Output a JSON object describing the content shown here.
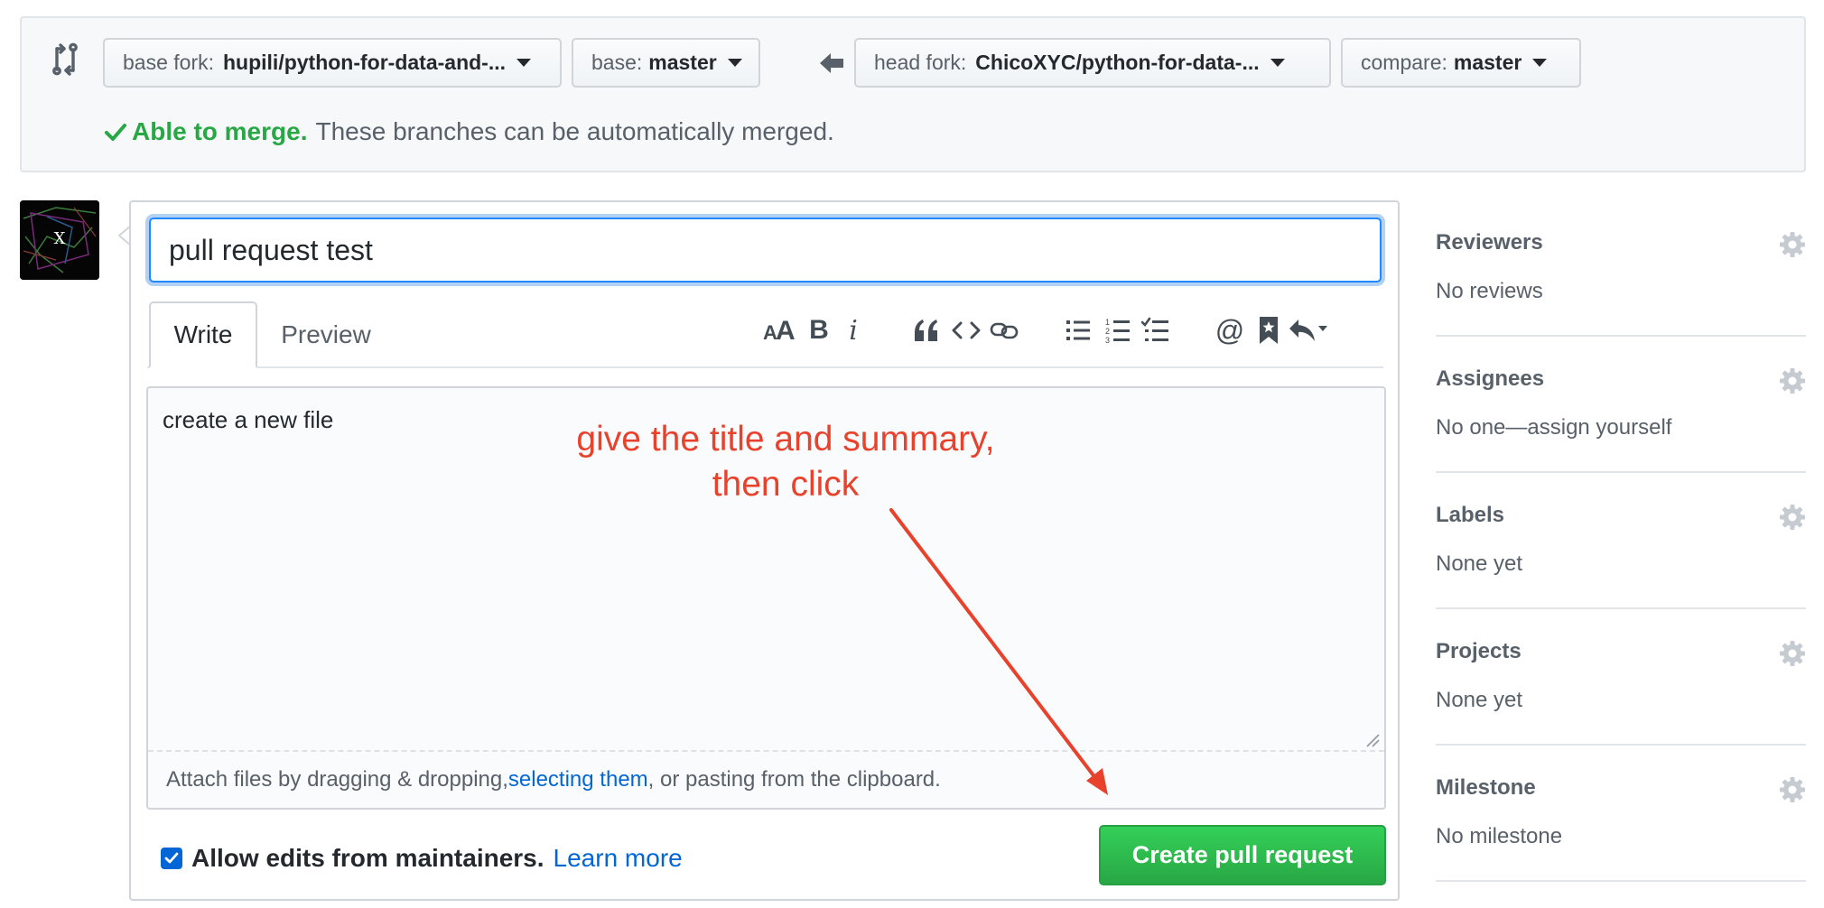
{
  "compare": {
    "base_fork": {
      "label": "base fork:",
      "value": "hupili/python-for-data-and-..."
    },
    "base": {
      "label": "base:",
      "value": "master"
    },
    "head_fork": {
      "label": "head fork:",
      "value": "ChicoXYC/python-for-data-..."
    },
    "compare": {
      "label": "compare:",
      "value": "master"
    },
    "merge_status_ok": "Able to merge.",
    "merge_status_text": "These branches can be automatically merged."
  },
  "avatar": {
    "letter": "X"
  },
  "composer": {
    "title_value": "pull request test",
    "tabs": [
      {
        "label": "Write",
        "active": true
      },
      {
        "label": "Preview",
        "active": false
      }
    ],
    "toolbar_icons": [
      "text-size-icon",
      "bold-icon",
      "italic-icon",
      "quote-icon",
      "code-icon",
      "link-icon",
      "unordered-list-icon",
      "ordered-list-icon",
      "task-list-icon",
      "mention-icon",
      "saved-reply-icon",
      "reply-icon"
    ],
    "body_value": "create a new file",
    "attach_prefix": "Attach files by dragging & dropping, ",
    "attach_link": "selecting them",
    "attach_suffix": ", or pasting from the clipboard.",
    "allow_edits_label": "Allow edits from maintainers.",
    "allow_edits_checked": true,
    "learn_more": "Learn more",
    "submit_label": "Create pull request"
  },
  "annotation": {
    "text": "give the title and summary,\nthen click",
    "color": "#e8412c"
  },
  "sidebar": {
    "sections": [
      {
        "heading": "Reviewers",
        "value": "No reviews"
      },
      {
        "heading": "Assignees",
        "value": "No one—assign yourself"
      },
      {
        "heading": "Labels",
        "value": "None yet"
      },
      {
        "heading": "Projects",
        "value": "None yet"
      },
      {
        "heading": "Milestone",
        "value": "No milestone"
      }
    ]
  },
  "colors": {
    "accent": "#0366d6",
    "success": "#28a745",
    "annotation": "#e8412c"
  }
}
